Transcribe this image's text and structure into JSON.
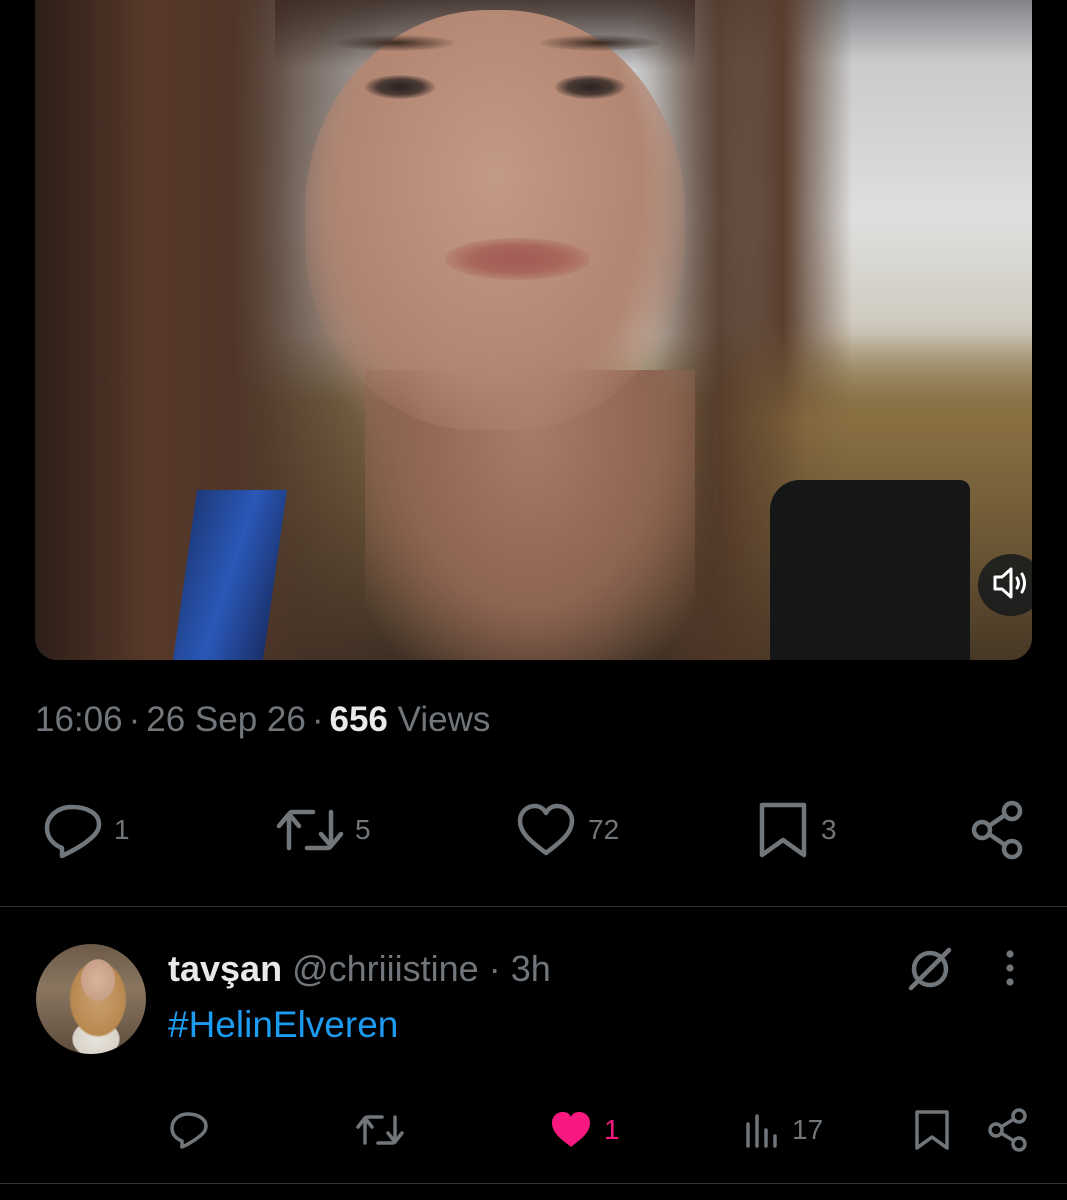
{
  "tweet": {
    "time": "16:06",
    "date": "26 Sep 26",
    "views_count": "656",
    "views_label": "Views",
    "separator": "·"
  },
  "actions_main": {
    "replies": "1",
    "reposts": "5",
    "likes": "72",
    "bookmarks": "3"
  },
  "reply": {
    "name": "tavşan",
    "handle": "@chriiistine",
    "separator": "·",
    "time": "3h",
    "text": "#HelinElveren",
    "actions": {
      "likes": "1",
      "views": "17"
    }
  },
  "colors": {
    "background": "#000000",
    "text_primary": "#e7e9ea",
    "text_secondary": "#71767b",
    "link": "#1d9bf0",
    "like_active": "#f91880",
    "divider": "#2f3336"
  },
  "icons": {
    "sound": "speaker-muted-icon",
    "reply": "reply-bubble-icon",
    "repost": "repost-arrows-icon",
    "like": "heart-icon",
    "bookmark": "bookmark-icon",
    "share": "share-icon",
    "grok": "grok-icon",
    "more": "more-vertical-icon",
    "views": "views-bar-icon"
  }
}
